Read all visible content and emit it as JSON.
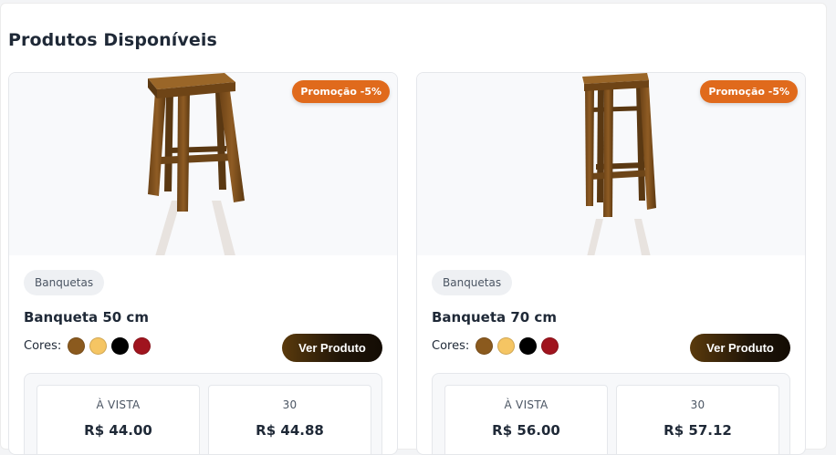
{
  "section": {
    "title": "Produtos Disponíveis"
  },
  "products": [
    {
      "badge": "Promoção -5%",
      "category": "Banquetas",
      "name": "Banqueta 50 cm",
      "colors_label": "Cores:",
      "colors": [
        "#8b5a1e",
        "#f5c563",
        "#000000",
        "#a0141e"
      ],
      "button_label": "Ver Produto",
      "prices": [
        {
          "label": "À VISTA",
          "value": "R$ 44.00"
        },
        {
          "label": "30",
          "value": "R$ 44.88"
        }
      ]
    },
    {
      "badge": "Promoção -5%",
      "category": "Banquetas",
      "name": "Banqueta 70 cm",
      "colors_label": "Cores:",
      "colors": [
        "#8b5a1e",
        "#f5c563",
        "#000000",
        "#a0141e"
      ],
      "button_label": "Ver Produto",
      "prices": [
        {
          "label": "À VISTA",
          "value": "R$ 56.00"
        },
        {
          "label": "30",
          "value": "R$ 57.12"
        }
      ]
    }
  ],
  "theme": {
    "badge_color": "#e06a1c",
    "button_color": "#2a1a08",
    "wood_color": "#7a4e1d"
  }
}
